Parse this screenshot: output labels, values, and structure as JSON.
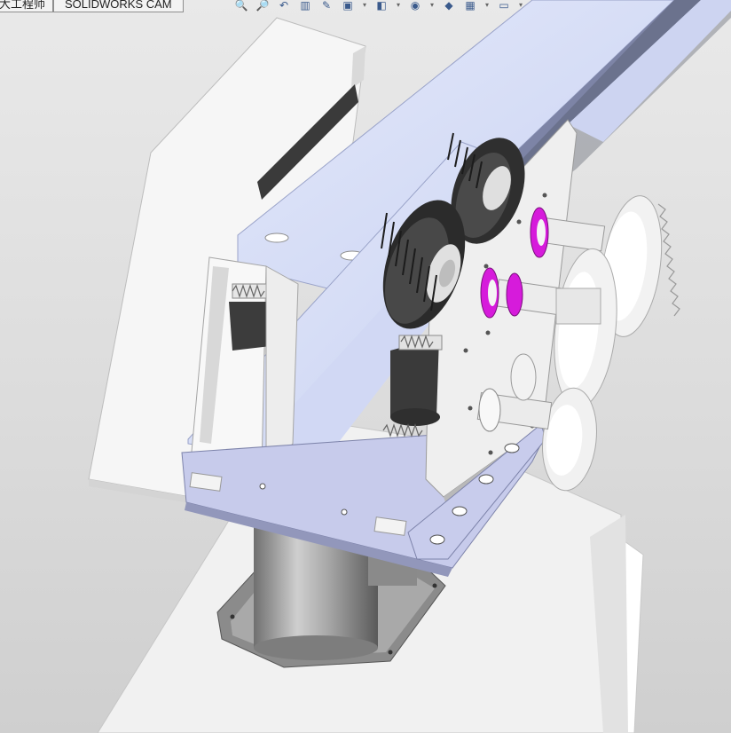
{
  "tabs": [
    {
      "label": "大工程师",
      "id": "engineer"
    },
    {
      "label": "SOLIDWORKS CAM",
      "id": "cam"
    }
  ],
  "toolbar": {
    "items": [
      {
        "name": "zoom-to-fit-icon",
        "glyph": "🔍"
      },
      {
        "name": "zoom-to-area-icon",
        "glyph": "🔎"
      },
      {
        "name": "previous-view-icon",
        "glyph": "↶"
      },
      {
        "name": "section-view-icon",
        "glyph": "▥"
      },
      {
        "name": "dynamic-annotation-icon",
        "glyph": "✎"
      },
      {
        "name": "view-orientation-icon",
        "glyph": "▣"
      },
      {
        "name": "dropdown-arrow-icon",
        "glyph": "▾"
      },
      {
        "name": "display-style-icon",
        "glyph": "◧"
      },
      {
        "name": "dropdown-arrow-icon",
        "glyph": "▾"
      },
      {
        "name": "hide-show-items-icon",
        "glyph": "◉"
      },
      {
        "name": "dropdown-arrow-icon",
        "glyph": "▾"
      },
      {
        "name": "edit-appearance-icon",
        "glyph": "◆"
      },
      {
        "name": "apply-scene-icon",
        "glyph": "▦"
      },
      {
        "name": "dropdown-arrow-icon",
        "glyph": "▾"
      },
      {
        "name": "view-settings-icon",
        "glyph": "▭"
      },
      {
        "name": "dropdown-arrow-icon",
        "glyph": "▾"
      }
    ]
  },
  "model": {
    "description": "3D CAD assembly: gearbox mechanism with dark timing-belt pulleys, magenta bearings, grey aluminium extrusion and cylindrical base",
    "colors": {
      "background": "#dcdcdc",
      "white_part": "#f7f7f7",
      "belt": "#3b3b3b",
      "bearing": "#d41ad9",
      "plate": "#c6cbe8",
      "extrusion": "#d5dcf5",
      "cylinder": "#8d8d8d"
    }
  }
}
